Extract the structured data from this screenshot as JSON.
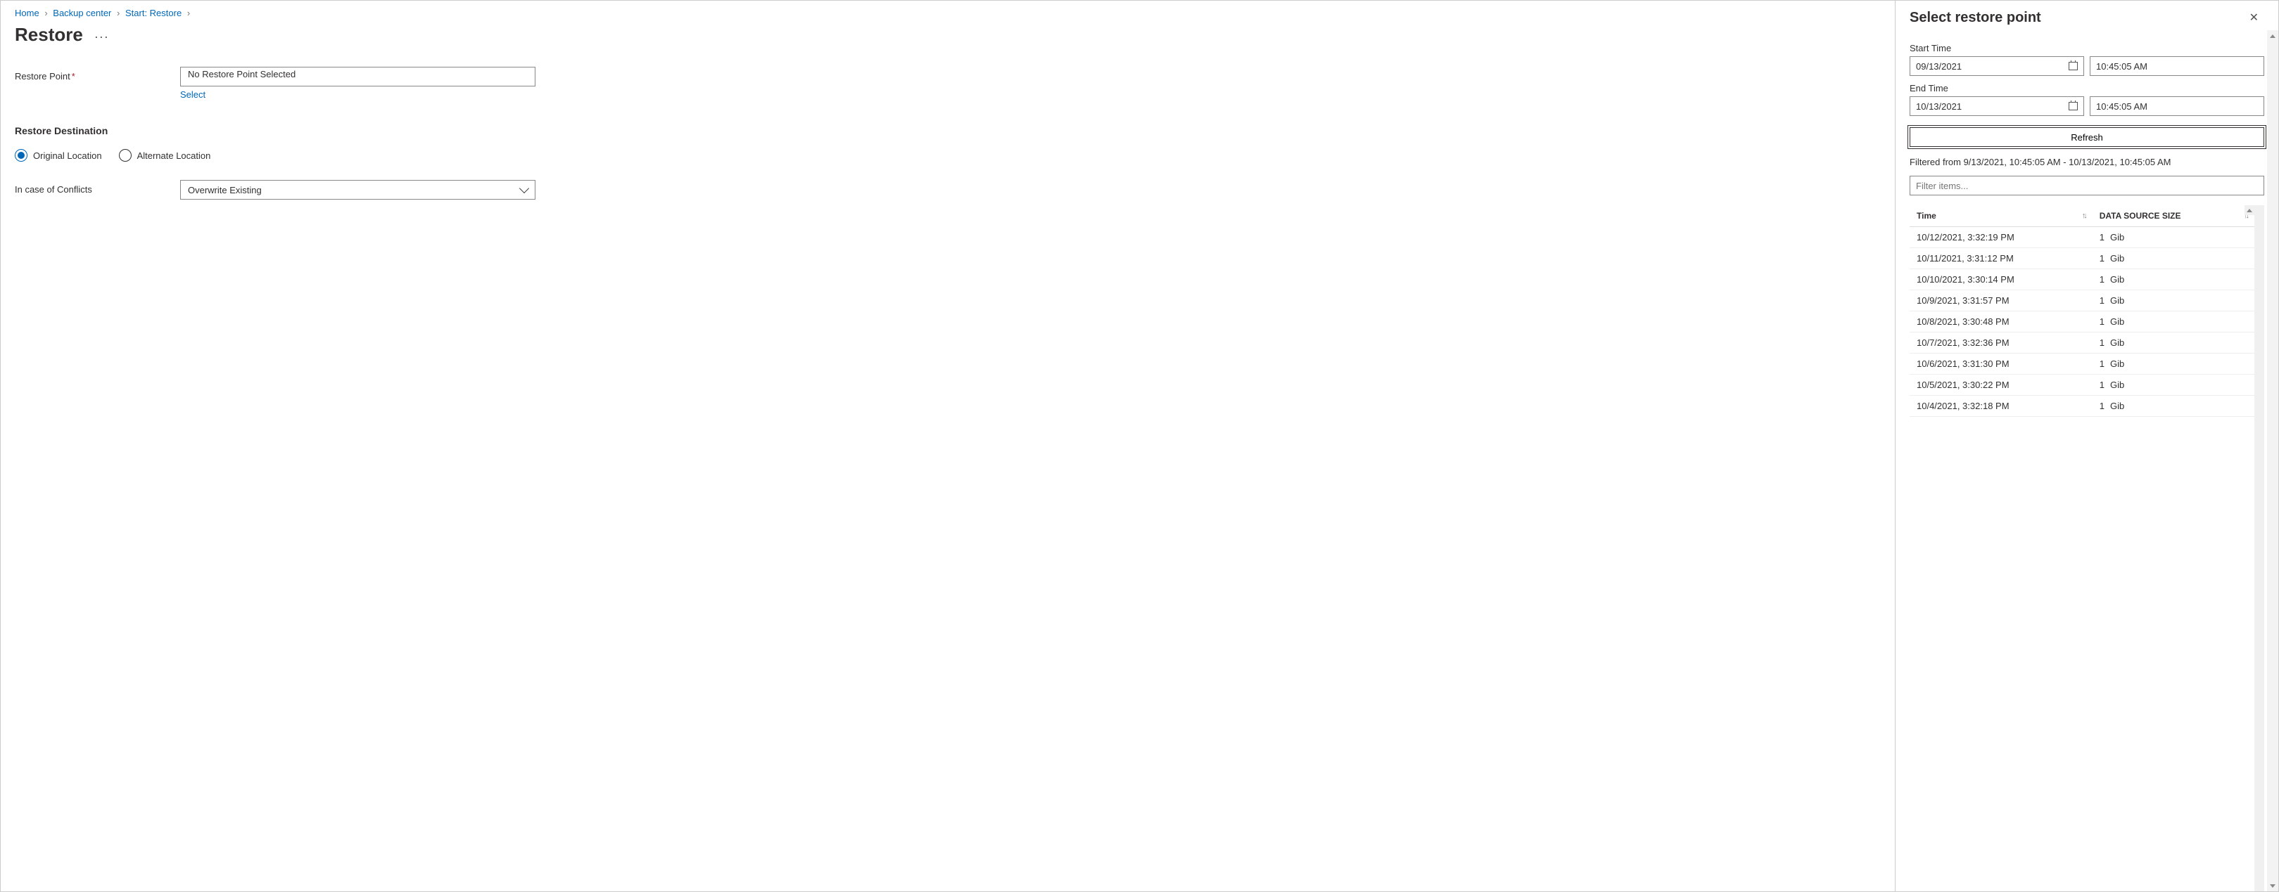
{
  "breadcrumb": {
    "items": [
      "Home",
      "Backup center",
      "Start: Restore"
    ]
  },
  "page": {
    "title": "Restore"
  },
  "form": {
    "restorePointLabel": "Restore Point",
    "restorePointValue": "No Restore Point Selected",
    "selectLink": "Select",
    "destinationHeader": "Restore Destination",
    "destOptions": {
      "original": "Original Location",
      "alternate": "Alternate Location"
    },
    "conflictsLabel": "In case of Conflicts",
    "conflictsValue": "Overwrite Existing"
  },
  "panel": {
    "title": "Select restore point",
    "startTimeLabel": "Start Time",
    "startDate": "09/13/2021",
    "startTime": "10:45:05 AM",
    "endTimeLabel": "End Time",
    "endDate": "10/13/2021",
    "endTime": "10:45:05 AM",
    "refreshBtn": "Refresh",
    "filteredText": "Filtered from 9/13/2021, 10:45:05 AM - 10/13/2021, 10:45:05 AM",
    "filterPlaceholder": "Filter items...",
    "columns": {
      "time": "Time",
      "size": "DATA SOURCE SIZE"
    },
    "rows": [
      {
        "time": "10/12/2021, 3:32:19 PM",
        "sizeNum": "1",
        "sizeUnit": "Gib"
      },
      {
        "time": "10/11/2021, 3:31:12 PM",
        "sizeNum": "1",
        "sizeUnit": "Gib"
      },
      {
        "time": "10/10/2021, 3:30:14 PM",
        "sizeNum": "1",
        "sizeUnit": "Gib"
      },
      {
        "time": "10/9/2021, 3:31:57 PM",
        "sizeNum": "1",
        "sizeUnit": "Gib"
      },
      {
        "time": "10/8/2021, 3:30:48 PM",
        "sizeNum": "1",
        "sizeUnit": "Gib"
      },
      {
        "time": "10/7/2021, 3:32:36 PM",
        "sizeNum": "1",
        "sizeUnit": "Gib"
      },
      {
        "time": "10/6/2021, 3:31:30 PM",
        "sizeNum": "1",
        "sizeUnit": "Gib"
      },
      {
        "time": "10/5/2021, 3:30:22 PM",
        "sizeNum": "1",
        "sizeUnit": "Gib"
      },
      {
        "time": "10/4/2021, 3:32:18 PM",
        "sizeNum": "1",
        "sizeUnit": "Gib"
      }
    ]
  }
}
